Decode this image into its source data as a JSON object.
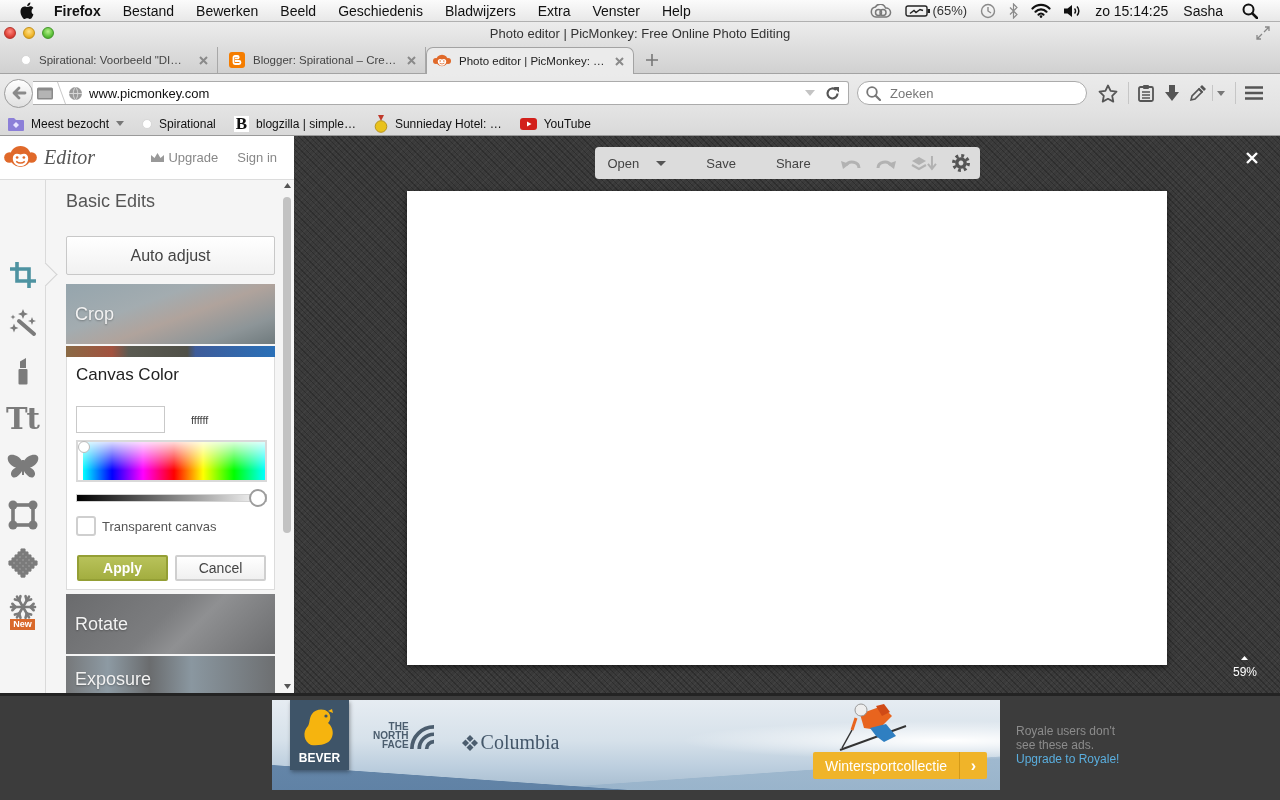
{
  "menubar": {
    "app": "Firefox",
    "menus": [
      "Bestand",
      "Bewerken",
      "Beeld",
      "Geschiedenis",
      "Bladwijzers",
      "Extra",
      "Venster",
      "Help"
    ],
    "battery": "(65%)",
    "clock": "zo 15:14:25",
    "user": "Sasha"
  },
  "window": {
    "title": "Photo editor | PicMonkey: Free Online Photo Editing"
  },
  "tabs": [
    {
      "kind": "dot",
      "label": "Spirational: Voorbeeld \"DI…",
      "selected": false
    },
    {
      "kind": "blogger",
      "label": "Blogger: Spirational – Cre…",
      "selected": false
    },
    {
      "kind": "monkey",
      "label": "Photo editor | PicMonkey: …",
      "selected": true
    }
  ],
  "navbar": {
    "url": "www.picmonkey.com",
    "search": {
      "placeholder": "Zoeken"
    }
  },
  "bookmarks": [
    {
      "kind": "folder",
      "label": "Meest bezocht"
    },
    {
      "kind": "dot",
      "label": "Spirational"
    },
    {
      "kind": "letter",
      "glyph": "B",
      "label": "blogzilla | simple…"
    },
    {
      "kind": "medal",
      "label": "Sunnieday Hotel: …"
    },
    {
      "kind": "video",
      "label": "YouTube"
    }
  ],
  "editor": {
    "header": {
      "title": "Editor",
      "upgrade": "Upgrade",
      "sign_in": "Sign in"
    },
    "rail": [
      {
        "kind": "crop",
        "selected": true
      },
      {
        "kind": "wand",
        "selected": false
      },
      {
        "kind": "lipstick",
        "selected": false
      },
      {
        "kind": "text",
        "label": "Tt",
        "selected": false
      },
      {
        "kind": "butterfly",
        "selected": false
      },
      {
        "kind": "frame",
        "selected": false
      },
      {
        "kind": "texture",
        "selected": false
      },
      {
        "kind": "snowflake",
        "badge": "New",
        "selected": false
      }
    ],
    "panel": {
      "title": "Basic Edits",
      "auto_adjust": "Auto adjust",
      "tools": [
        {
          "label": "Crop",
          "expanded": false
        },
        {
          "label": "Canvas Color",
          "expanded": true,
          "hex": "ffffff",
          "brightness": {
            "level": 1
          },
          "transparent": {
            "label": "Transparent canvas",
            "checked": false
          },
          "buttons": [
            {
              "kind": "primary",
              "label": "Apply"
            },
            {
              "kind": "secondary",
              "label": "Cancel"
            }
          ]
        },
        {
          "label": "Rotate",
          "expanded": false
        },
        {
          "label": "Exposure",
          "expanded": false
        }
      ]
    }
  },
  "canvas_toolbar": {
    "buttons": [
      {
        "kind": "menu",
        "label": "Open"
      },
      {
        "kind": "plain",
        "label": "Save"
      },
      {
        "kind": "plain",
        "label": "Share"
      }
    ],
    "icons": [
      {
        "kind": "undo",
        "disabled": true
      },
      {
        "kind": "redo",
        "disabled": true
      },
      {
        "kind": "layers",
        "disabled": true
      },
      {
        "kind": "settings",
        "disabled": false
      }
    ]
  },
  "zoom": {
    "label": "59%"
  },
  "ad": {
    "brands": [
      {
        "kind": "bever",
        "label": "BEVER"
      },
      {
        "kind": "northface",
        "label": "THE NORTH FACE"
      },
      {
        "kind": "columbia",
        "label": "Columbia"
      }
    ],
    "cta": "Wintersportcollectie",
    "cta_arrow": "›"
  },
  "ad_note": {
    "text": "Royale users don't see these ads.",
    "link": "Upgrade to Royale!"
  }
}
